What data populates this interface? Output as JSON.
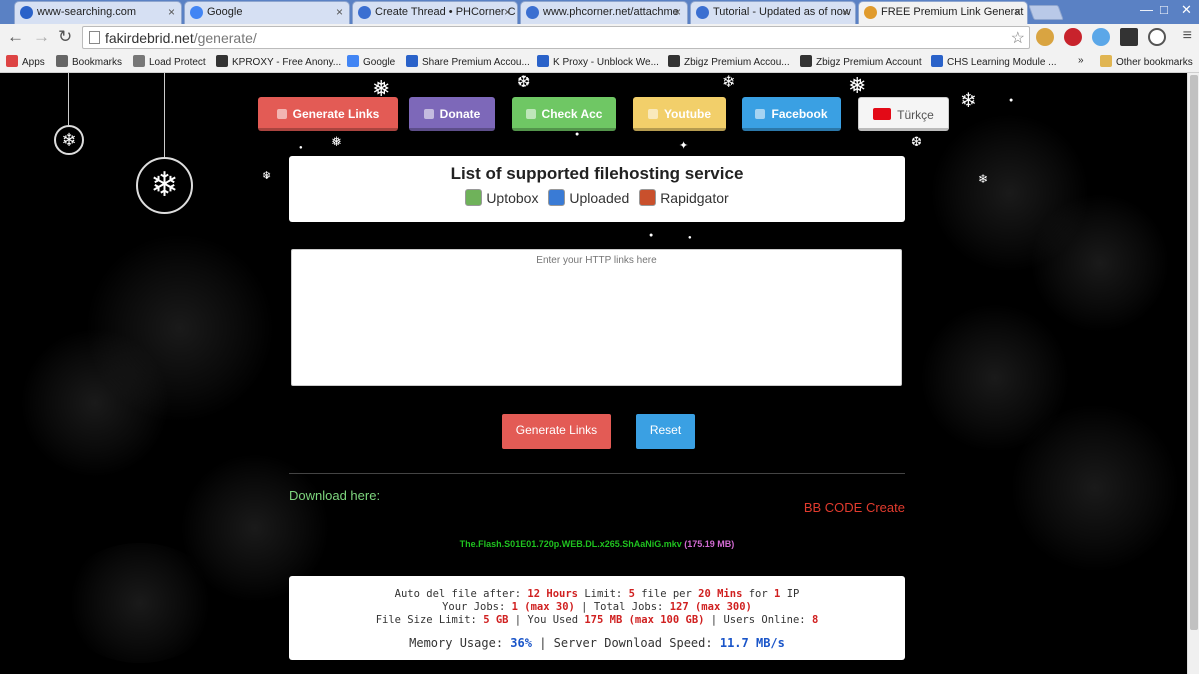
{
  "browser": {
    "tabs": [
      {
        "title": "www-searching.com",
        "active": false,
        "favicon_color": "#2a62c9"
      },
      {
        "title": "Google",
        "active": false,
        "favicon_color": "#4285f4"
      },
      {
        "title": "Create Thread • PHCorner C",
        "active": false,
        "favicon_color": "#3b6fd1"
      },
      {
        "title": "www.phcorner.net/attachme",
        "active": false,
        "favicon_color": "#3b6fd1"
      },
      {
        "title": "Tutorial - Updated as of now",
        "active": false,
        "favicon_color": "#3b6fd1"
      },
      {
        "title": "FREE Premium Link Generat",
        "active": true,
        "favicon_color": "#e09b2d"
      }
    ],
    "url_host": "fakirdebrid.net",
    "url_path": "/generate/",
    "bookmarks": [
      {
        "label": "Apps",
        "icon_color": "#d44"
      },
      {
        "label": "Bookmarks",
        "icon_color": "#666"
      },
      {
        "label": "Load Protect",
        "icon_color": "#777"
      },
      {
        "label": "KPROXY - Free Anony...",
        "icon_color": "#333"
      },
      {
        "label": "Google",
        "icon_color": "#4285f4"
      },
      {
        "label": "Share Premium Accou...",
        "icon_color": "#2a62c9"
      },
      {
        "label": "K Proxy - Unblock We...",
        "icon_color": "#2a62c9"
      },
      {
        "label": "Zbigz Premium Accou...",
        "icon_color": "#333"
      },
      {
        "label": "Zbigz Premium Account",
        "icon_color": "#333"
      },
      {
        "label": "CHS Learning Module ...",
        "icon_color": "#2a62c9"
      }
    ],
    "more_bookmarks": "»",
    "other_bookmarks": "Other bookmarks"
  },
  "nav_buttons": [
    {
      "label": "Generate Links",
      "color": "#e35b55"
    },
    {
      "label": "Donate",
      "color": "#7d68b9"
    },
    {
      "label": "Check Acc",
      "color": "#6fc764"
    },
    {
      "label": "Youtube",
      "color": "#f2cf6a"
    },
    {
      "label": "Facebook",
      "color": "#3aa0e3"
    },
    {
      "label": "Türkçe",
      "color": "#f5f5f5"
    }
  ],
  "hosting": {
    "title": "List of supported filehosting service",
    "hosts": [
      {
        "name": "Uptobox",
        "icon_color": "#6fb25a"
      },
      {
        "name": "Uploaded",
        "icon_color": "#3a7bd5"
      },
      {
        "name": "Rapidgator",
        "icon_color": "#c9502c"
      }
    ]
  },
  "links_input": {
    "placeholder": "Enter your HTTP links here",
    "value": ""
  },
  "actions": {
    "generate": "Generate Links",
    "reset": "Reset"
  },
  "download": {
    "heading": "Download here:",
    "bbcode": "BB CODE Create",
    "filename": "The.Flash.S01E01.720p.WEB.DL.x265.ShAaNiG.mkv",
    "filesize": "(175.19 MB)"
  },
  "stats": {
    "auto_del_label": "Auto del file after:",
    "auto_del_value": "12 Hours",
    "limit_label": "Limit:",
    "limit_files": "5",
    "file_per_label": "file per",
    "limit_window": "20 Mins",
    "for_label": "for",
    "limit_ip_count": "1",
    "ip_label": "IP",
    "your_jobs_label": "Your Jobs:",
    "your_jobs_value": "1 (max 30)",
    "total_jobs_label": "Total Jobs:",
    "total_jobs_value": "127 (max 300)",
    "size_limit_label": "File Size Limit:",
    "size_limit_value": "5 GB",
    "used_label": "You Used",
    "used_value": "175 MB (max 100 GB)",
    "online_label": "Users Online:",
    "online_value": "8",
    "memory_label": "Memory Usage:",
    "memory_value": "36%",
    "speed_label": "Server Download Speed:",
    "speed_value": "11.7 MB/s"
  }
}
